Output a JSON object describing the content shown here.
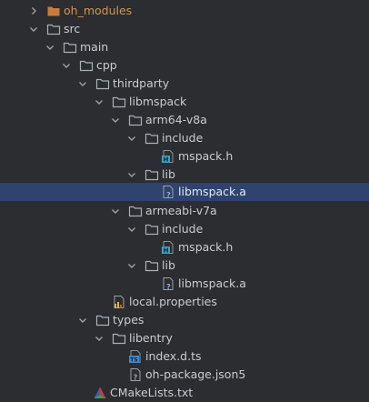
{
  "colors": {
    "background": "#2b2d30",
    "selection": "#2e436e",
    "text": "#c9ccd1",
    "excluded_folder_text": "#d29553",
    "folder_icon": "#a9b0b8",
    "excluded_folder_icon": "#c97b3c",
    "header_file_icon": "#3ea0c2"
  },
  "tree": {
    "oh_modules": {
      "label": "oh_modules",
      "icon": "folder-excluded-icon",
      "expanded": false
    },
    "src": {
      "label": "src",
      "icon": "folder-icon",
      "expanded": true
    },
    "main": {
      "label": "main",
      "icon": "folder-icon",
      "expanded": true
    },
    "cpp": {
      "label": "cpp",
      "icon": "folder-icon",
      "expanded": true
    },
    "thirdparty": {
      "label": "thirdparty",
      "icon": "folder-icon",
      "expanded": true
    },
    "libmspack": {
      "label": "libmspack",
      "icon": "folder-icon",
      "expanded": true
    },
    "arm64": {
      "label": "arm64-v8a",
      "icon": "folder-icon",
      "expanded": true
    },
    "arm64_include": {
      "label": "include",
      "icon": "folder-icon",
      "expanded": true
    },
    "arm64_mspack_h": {
      "label": "mspack.h",
      "icon": "header-file-icon"
    },
    "arm64_lib": {
      "label": "lib",
      "icon": "folder-icon",
      "expanded": true
    },
    "arm64_libmspack_a": {
      "label": "libmspack.a",
      "icon": "unknown-file-icon",
      "selected": true
    },
    "armeabi": {
      "label": "armeabi-v7a",
      "icon": "folder-icon",
      "expanded": true
    },
    "armeabi_include": {
      "label": "include",
      "icon": "folder-icon",
      "expanded": true
    },
    "armeabi_mspack_h": {
      "label": "mspack.h",
      "icon": "header-file-icon"
    },
    "armeabi_lib": {
      "label": "lib",
      "icon": "folder-icon",
      "expanded": true
    },
    "armeabi_libmspack_a": {
      "label": "libmspack.a",
      "icon": "unknown-file-icon"
    },
    "local_properties": {
      "label": "local.properties",
      "icon": "properties-file-icon"
    },
    "types": {
      "label": "types",
      "icon": "folder-icon",
      "expanded": true
    },
    "libentry": {
      "label": "libentry",
      "icon": "folder-icon",
      "expanded": true
    },
    "index_d_ts": {
      "label": "index.d.ts",
      "icon": "typescript-file-icon"
    },
    "oh_package": {
      "label": "oh-package.json5",
      "icon": "json5-file-icon"
    },
    "cmakelists": {
      "label": "CMakeLists.txt",
      "icon": "cmake-file-icon"
    }
  }
}
